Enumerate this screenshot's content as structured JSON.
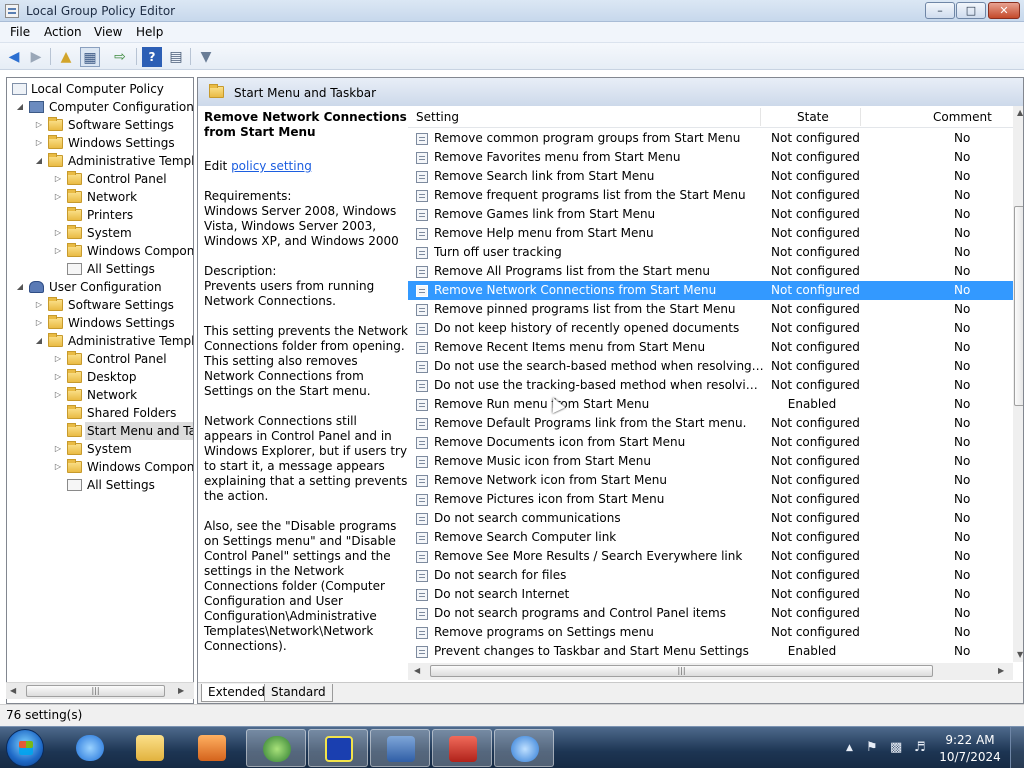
{
  "window": {
    "title": "Local Group Policy Editor",
    "min": "–",
    "max": "□",
    "close": "✕"
  },
  "menu": [
    "File",
    "Action",
    "View",
    "Help"
  ],
  "toolbar": {
    "icons": [
      "back-arrow-icon",
      "forward-arrow-icon",
      "up-folder-icon",
      "show-hide-console-tree-icon",
      "export-list-icon",
      "help-icon",
      "properties-icon",
      "filter-icon"
    ]
  },
  "tree": [
    {
      "label": "Local Computer Policy",
      "icon": "policy"
    },
    {
      "label": "Computer Configuration",
      "icon": "computer",
      "exp": "◢"
    },
    {
      "label": "Software Settings",
      "icon": "folder",
      "exp": "▷"
    },
    {
      "label": "Windows Settings",
      "icon": "folder",
      "exp": "▷"
    },
    {
      "label": "Administrative Templat",
      "icon": "folder",
      "exp": "◢"
    },
    {
      "label": "Control Panel",
      "icon": "folder",
      "exp": "▷"
    },
    {
      "label": "Network",
      "icon": "folder",
      "exp": "▷"
    },
    {
      "label": "Printers",
      "icon": "folder",
      "exp": ""
    },
    {
      "label": "System",
      "icon": "folder",
      "exp": "▷"
    },
    {
      "label": "Windows Compone",
      "icon": "folder",
      "exp": "▷"
    },
    {
      "label": "All Settings",
      "icon": "settings",
      "exp": ""
    },
    {
      "label": "User Configuration",
      "icon": "user",
      "exp": "◢"
    },
    {
      "label": "Software Settings",
      "icon": "folder",
      "exp": "▷"
    },
    {
      "label": "Windows Settings",
      "icon": "folder",
      "exp": "▷"
    },
    {
      "label": "Administrative Templat",
      "icon": "folder",
      "exp": "◢"
    },
    {
      "label": "Control Panel",
      "icon": "folder",
      "exp": "▷"
    },
    {
      "label": "Desktop",
      "icon": "folder",
      "exp": "▷"
    },
    {
      "label": "Network",
      "icon": "folder",
      "exp": "▷"
    },
    {
      "label": "Shared Folders",
      "icon": "folder",
      "exp": ""
    },
    {
      "label": "Start Menu and Taskb",
      "icon": "folder",
      "exp": "",
      "selected": true
    },
    {
      "label": "System",
      "icon": "folder",
      "exp": "▷"
    },
    {
      "label": "Windows Compone",
      "icon": "folder",
      "exp": "▷"
    },
    {
      "label": "All Settings",
      "icon": "settings",
      "exp": ""
    }
  ],
  "section": {
    "title": "Start Menu and Taskbar"
  },
  "description": {
    "heading": "Remove Network Connections from Start Menu",
    "edit_prefix": "Edit ",
    "edit_link": "policy setting",
    "requirements": "Requirements:\nWindows Server 2008, Windows Vista, Windows Server 2003, Windows XP, and Windows 2000",
    "description": "Description:\nPrevents users from running Network Connections.",
    "para1": "This setting prevents the Network Connections folder from opening. This setting also removes Network Connections from Settings on the Start menu.",
    "para2": "Network Connections still appears in Control Panel and in Windows Explorer, but if users try to start it, a message appears explaining that a setting prevents the action.",
    "para3": "Also, see the \"Disable programs on Settings menu\" and \"Disable Control Panel\" settings and the settings in the Network Connections folder (Computer Configuration and User Configuration\\Administrative Templates\\Network\\Network Connections)."
  },
  "list": {
    "columns": {
      "setting": "Setting",
      "state": "State",
      "comment": "Comment"
    },
    "rows": [
      {
        "setting": "Remove common program groups from Start Menu",
        "state": "Not configured",
        "comment": "No"
      },
      {
        "setting": "Remove Favorites menu from Start Menu",
        "state": "Not configured",
        "comment": "No"
      },
      {
        "setting": "Remove Search link from Start Menu",
        "state": "Not configured",
        "comment": "No"
      },
      {
        "setting": "Remove frequent programs list from the Start Menu",
        "state": "Not configured",
        "comment": "No"
      },
      {
        "setting": "Remove Games link from Start Menu",
        "state": "Not configured",
        "comment": "No"
      },
      {
        "setting": "Remove Help menu from Start Menu",
        "state": "Not configured",
        "comment": "No"
      },
      {
        "setting": "Turn off user tracking",
        "state": "Not configured",
        "comment": "No"
      },
      {
        "setting": "Remove All Programs list from the Start menu",
        "state": "Not configured",
        "comment": "No"
      },
      {
        "setting": "Remove Network Connections from Start Menu",
        "state": "Not configured",
        "comment": "No",
        "selected": true
      },
      {
        "setting": "Remove pinned programs list from the Start Menu",
        "state": "Not configured",
        "comment": "No"
      },
      {
        "setting": "Do not keep history of recently opened documents",
        "state": "Not configured",
        "comment": "No"
      },
      {
        "setting": "Remove Recent Items menu from Start Menu",
        "state": "Not configured",
        "comment": "No"
      },
      {
        "setting": "Do not use the search-based method when resolving shell s...",
        "state": "Not configured",
        "comment": "No"
      },
      {
        "setting": "Do not use the tracking-based method when resolving shell ...",
        "state": "Not configured",
        "comment": "No"
      },
      {
        "setting": "Remove Run menu from Start Menu",
        "state": "Enabled",
        "comment": "No",
        "center": true
      },
      {
        "setting": "Remove Default Programs link from the Start menu.",
        "state": "Not configured",
        "comment": "No"
      },
      {
        "setting": "Remove Documents icon from Start Menu",
        "state": "Not configured",
        "comment": "No"
      },
      {
        "setting": "Remove Music icon from Start Menu",
        "state": "Not configured",
        "comment": "No"
      },
      {
        "setting": "Remove Network icon from Start Menu",
        "state": "Not configured",
        "comment": "No"
      },
      {
        "setting": "Remove Pictures icon from Start Menu",
        "state": "Not configured",
        "comment": "No"
      },
      {
        "setting": "Do not search communications",
        "state": "Not configured",
        "comment": "No"
      },
      {
        "setting": "Remove Search Computer link",
        "state": "Not configured",
        "comment": "No"
      },
      {
        "setting": "Remove See More Results / Search Everywhere link",
        "state": "Not configured",
        "comment": "No"
      },
      {
        "setting": "Do not search for files",
        "state": "Not configured",
        "comment": "No"
      },
      {
        "setting": "Do not search Internet",
        "state": "Not configured",
        "comment": "No"
      },
      {
        "setting": "Do not search programs and Control Panel items",
        "state": "Not configured",
        "comment": "No"
      },
      {
        "setting": "Remove programs on Settings menu",
        "state": "Not configured",
        "comment": "No"
      },
      {
        "setting": "Prevent changes to Taskbar and Start Menu Settings",
        "state": "Enabled",
        "comment": "No",
        "center": true
      }
    ]
  },
  "tabs": {
    "extended": "Extended",
    "standard": "Standard"
  },
  "status": {
    "text": "76 setting(s)"
  },
  "taskbar": {
    "apps": [
      "internet-explorer-icon",
      "windows-explorer-icon",
      "media-player-icon",
      "network-globe-icon",
      "network-map-icon",
      "server-manager-icon",
      "toolbox-icon",
      "tool-icon"
    ],
    "tray_icons": [
      "show-hidden-icons-icon",
      "flag-icon",
      "network-icon",
      "volume-icon"
    ],
    "time": "9:22 AM",
    "date": "10/7/2024"
  },
  "colors": {
    "selection": "#3399ff",
    "link": "#1c5ee0"
  }
}
